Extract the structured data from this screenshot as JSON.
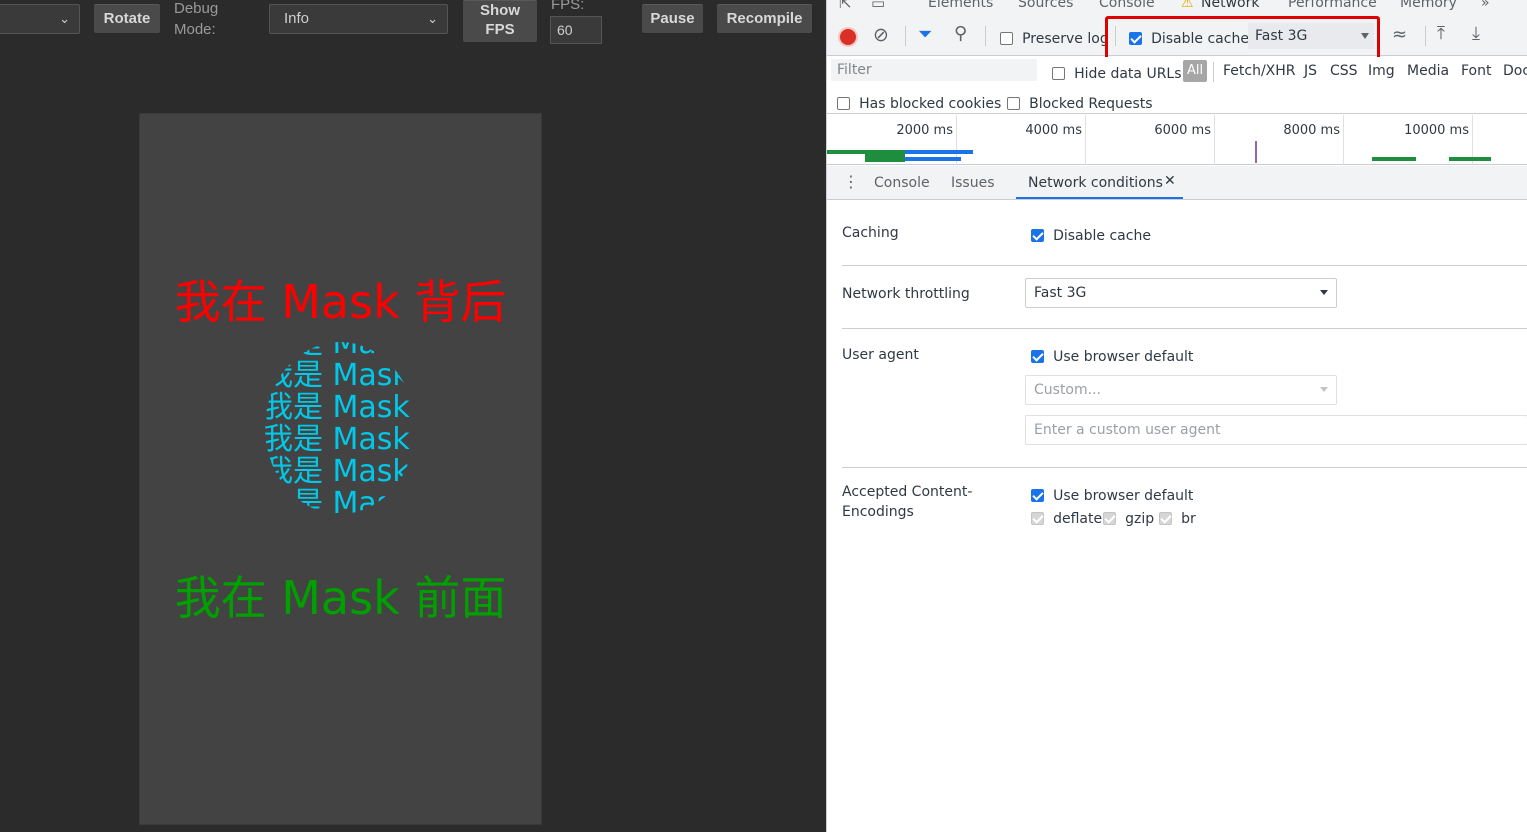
{
  "preview": {
    "toolbar": {
      "debug_label": "Debug\nMode:",
      "debug_value": "Info",
      "rotate_label": "Rotate",
      "show_fps_label": "Show\nFPS",
      "fps_label": "FPS:",
      "fps_value": "60",
      "pause_label": "Pause",
      "recompile_label": "Recompile"
    },
    "stage": {
      "behind_text": "我在 Mask 背后",
      "behind_color": "#ff0000",
      "mask_text": "我是 Mask",
      "mask_color": "#00c8e8",
      "front_text": "我在 Mask 前面",
      "front_color": "#00a000",
      "background": "#434343"
    }
  },
  "devtools": {
    "tabs": [
      "Elements",
      "Sources",
      "Console",
      "Network",
      "Performance",
      "Memory"
    ],
    "active_tab": "Network",
    "toolbar": {
      "preserve_log": "Preserve log",
      "preserve_log_checked": false,
      "disable_cache": "Disable cache",
      "disable_cache_checked": true,
      "throttle_value": "Fast 3G"
    },
    "filter": {
      "placeholder": "Filter",
      "hide_data_urls": "Hide data URLs",
      "types": [
        "All",
        "Fetch/XHR",
        "JS",
        "CSS",
        "Img",
        "Media",
        "Font",
        "Doc"
      ]
    },
    "blocked": {
      "has_blocked_cookies": "Has blocked cookies",
      "blocked_requests": "Blocked Requests"
    },
    "timeline": {
      "ticks": [
        "2000 ms",
        "4000 ms",
        "6000 ms",
        "8000 ms",
        "10000 ms"
      ]
    },
    "drawer_tabs": [
      "Console",
      "Issues",
      "Network conditions"
    ],
    "network_conditions": {
      "caching_label": "Caching",
      "disable_cache": "Disable cache",
      "throttling_label": "Network throttling",
      "throttling_value": "Fast 3G",
      "user_agent_label": "User agent",
      "use_browser_default": "Use browser default",
      "custom_select": "Custom...",
      "custom_ua_placeholder": "Enter a custom user agent",
      "encodings_label": "Accepted Content-\nEncodings",
      "encodings": [
        "deflate",
        "gzip",
        "br"
      ]
    },
    "highlight_color": "#e00000",
    "accent_color": "#1a73e8"
  }
}
